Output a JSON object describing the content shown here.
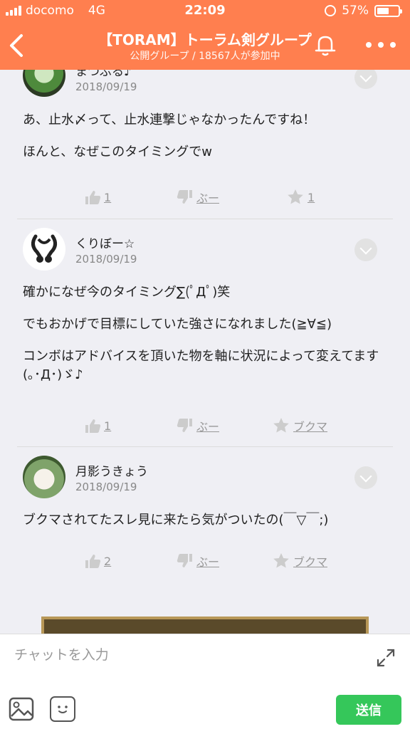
{
  "status_bar": {
    "carrier": "docomo",
    "network": "4G",
    "time": "22:09",
    "battery": "57%",
    "battery_level": 0.57
  },
  "header": {
    "title": "【TORAM】トーラム剣グループ",
    "subtitle": "公開グループ / 18567人が参加中",
    "accent_color": "#ff7f4f"
  },
  "posts": [
    {
      "name": "まつぶる♪",
      "date": "2018/09/19",
      "lines": [
        "あ、止水〆って、止水連撃じゃなかったんですね！",
        "ほんと、なぜこのタイミングでw"
      ],
      "like_count": "1",
      "boo_label": "ぶー",
      "fav_label": "1"
    },
    {
      "name": "くりぼー☆",
      "date": "2018/09/19",
      "lines": [
        "確かになぜ今のタイミング∑(ﾟДﾟ)笑",
        "でもおかげで目標にしていた強さになれました(≧∀≦)",
        "コンボはアドバイスを頂いた物を軸に状況によって変えてます(｡･Д･)ゞ♪"
      ],
      "like_count": "1",
      "boo_label": "ぶー",
      "fav_label": "ブクマ"
    },
    {
      "name": "月影うきょう",
      "date": "2018/09/19",
      "lines": [
        "ブクマされてたスレ見に来たら気がついたの(￣▽￣;)"
      ],
      "like_count": "2",
      "boo_label": "ぶー",
      "fav_label": "ブクマ"
    }
  ],
  "input": {
    "placeholder": "チャットを入力",
    "send_label": "送信",
    "send_color": "#35c75a"
  }
}
